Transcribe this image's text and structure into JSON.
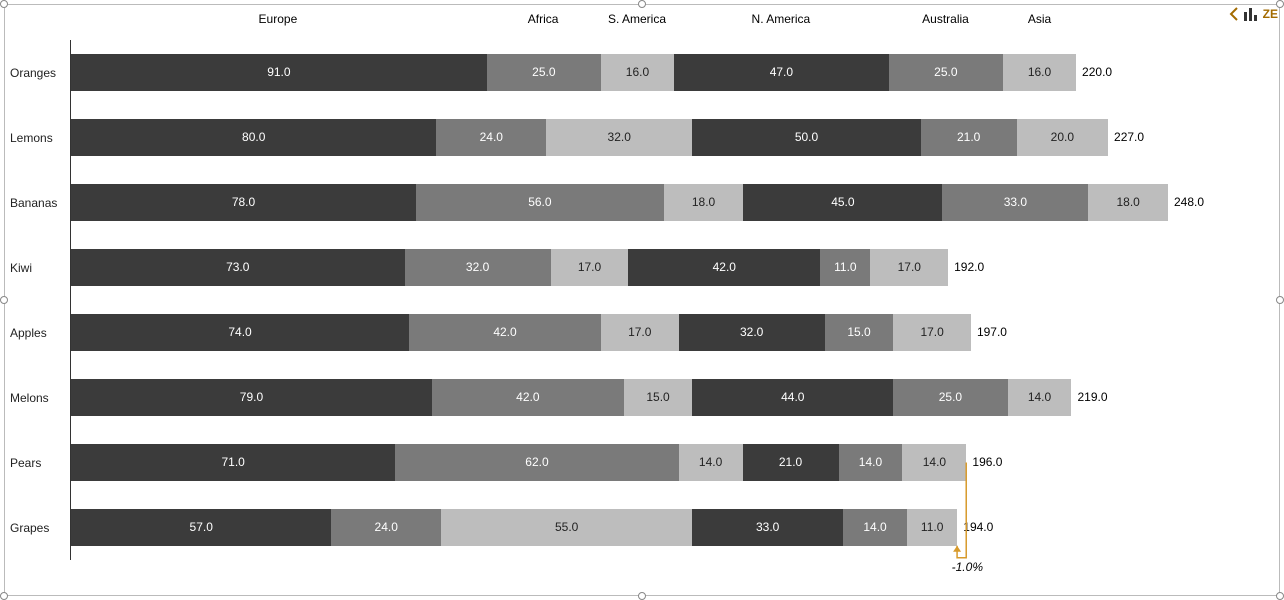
{
  "chart_data": {
    "type": "bar",
    "orientation": "horizontal",
    "stacked": true,
    "categories": [
      "Oranges",
      "Lemons",
      "Bananas",
      "Kiwi",
      "Apples",
      "Melons",
      "Pears",
      "Grapes"
    ],
    "series": [
      {
        "name": "Europe",
        "values": [
          91.0,
          80.0,
          78.0,
          73.0,
          74.0,
          79.0,
          71.0,
          57.0
        ]
      },
      {
        "name": "Africa",
        "values": [
          25.0,
          24.0,
          56.0,
          32.0,
          42.0,
          42.0,
          62.0,
          24.0
        ]
      },
      {
        "name": "S. America",
        "values": [
          16.0,
          32.0,
          18.0,
          17.0,
          17.0,
          15.0,
          14.0,
          55.0
        ]
      },
      {
        "name": "N. America",
        "values": [
          47.0,
          50.0,
          45.0,
          42.0,
          32.0,
          44.0,
          21.0,
          33.0
        ]
      },
      {
        "name": "Australia",
        "values": [
          25.0,
          21.0,
          33.0,
          11.0,
          15.0,
          25.0,
          14.0,
          14.0
        ]
      },
      {
        "name": "Asia",
        "values": [
          16.0,
          20.0,
          18.0,
          17.0,
          17.0,
          14.0,
          14.0,
          11.0
        ]
      }
    ],
    "totals": [
      220.0,
      227.0,
      248.0,
      192.0,
      197.0,
      219.0,
      196.0,
      194.0
    ],
    "delta": {
      "from": "Pears",
      "to": "Grapes",
      "label": "-1.0%"
    },
    "colors": [
      "#3b3b3b",
      "#7a7a7a",
      "#bdbdbd",
      "#3b3b3b",
      "#7a7a7a",
      "#bdbdbd"
    ]
  },
  "toolbar": {
    "badge_text": "ZE"
  }
}
